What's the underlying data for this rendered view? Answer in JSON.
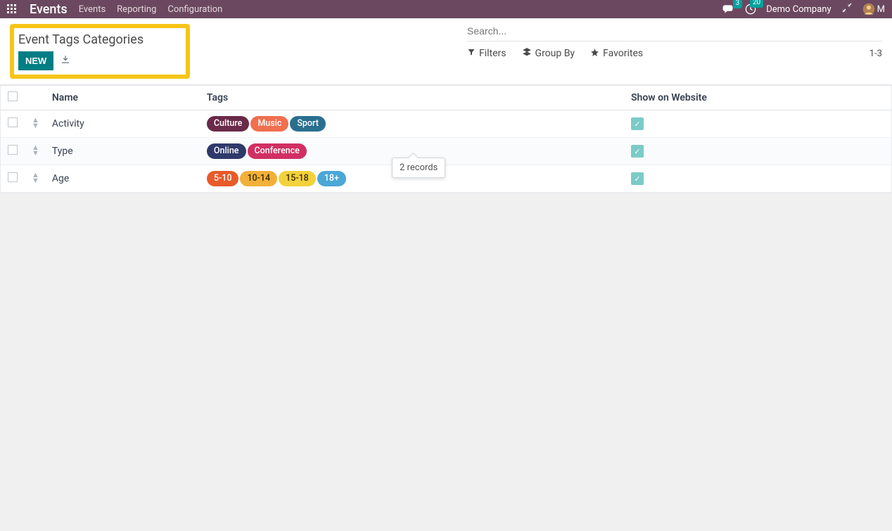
{
  "nav": {
    "brand": "Events",
    "items": [
      "Events",
      "Reporting",
      "Configuration"
    ],
    "chat_badge": "3",
    "activity_badge": "20",
    "company": "Demo Company",
    "user_initial": "M"
  },
  "control_panel": {
    "title": "Event Tags Categories",
    "new_label": "NEW",
    "search_placeholder": "Search...",
    "filters_label": "Filters",
    "groupby_label": "Group By",
    "favorites_label": "Favorites",
    "pager": "1-3"
  },
  "table": {
    "columns": {
      "name": "Name",
      "tags": "Tags",
      "show": "Show on Website"
    },
    "rows": [
      {
        "name": "Activity",
        "tags": [
          {
            "text": "Culture",
            "color": "#6a2a4a"
          },
          {
            "text": "Music",
            "color": "#f06f4f"
          },
          {
            "text": "Sport",
            "color": "#2a6f8f"
          }
        ],
        "show": true
      },
      {
        "name": "Type",
        "tags": [
          {
            "text": "Online",
            "color": "#2f3a6b"
          },
          {
            "text": "Conference",
            "color": "#d12f63"
          }
        ],
        "show": true
      },
      {
        "name": "Age",
        "tags": [
          {
            "text": "5-10",
            "color": "#e85a2a"
          },
          {
            "text": "10-14",
            "color": "#f2b03a",
            "textColor": "#3a2a00"
          },
          {
            "text": "15-18",
            "color": "#f2d23a",
            "textColor": "#3a2a00"
          },
          {
            "text": "18+",
            "color": "#4aa7d6"
          }
        ],
        "show": true
      }
    ]
  },
  "tooltip": {
    "text": "2 records"
  }
}
